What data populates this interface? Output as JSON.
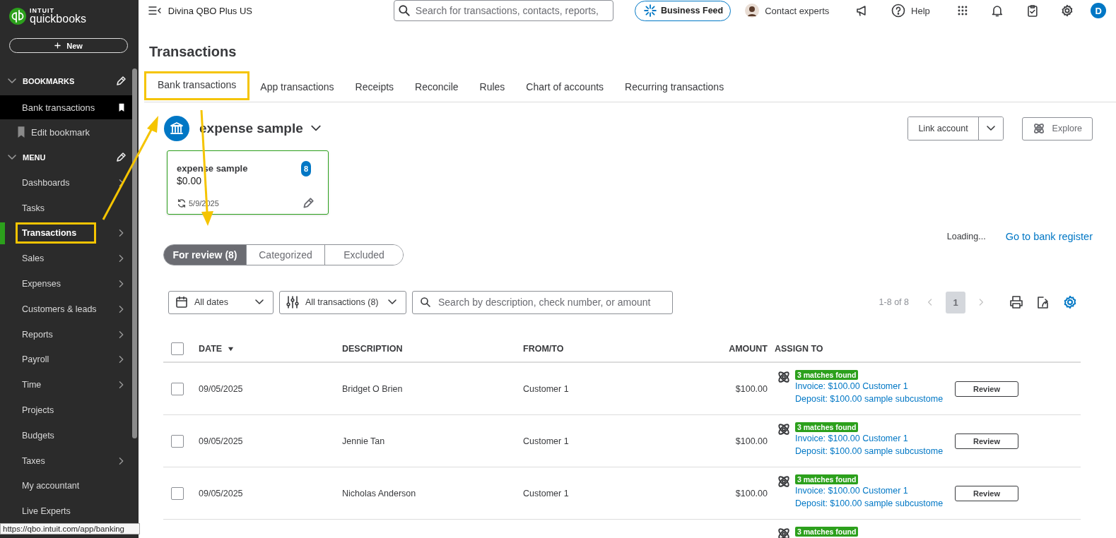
{
  "sidebar": {
    "logo": {
      "maker": "INTUIT",
      "product": "quickbooks"
    },
    "new_button": "New",
    "bookmarks": {
      "title": "BOOKMARKS",
      "expanded": true,
      "items": [
        {
          "label": "Bank transactions",
          "selected": true
        }
      ],
      "edit_label": "Edit bookmark"
    },
    "menu": {
      "title": "MENU",
      "expanded": true,
      "items": [
        {
          "label": "Dashboards",
          "selected": false,
          "submenu": true,
          "highlighted": false
        },
        {
          "label": "Tasks",
          "selected": false,
          "submenu": false,
          "highlighted": false
        },
        {
          "label": "Transactions",
          "selected": true,
          "submenu": true,
          "highlighted": true
        },
        {
          "label": "Sales",
          "selected": false,
          "submenu": true,
          "highlighted": false
        },
        {
          "label": "Expenses",
          "selected": false,
          "submenu": true,
          "highlighted": false
        },
        {
          "label": "Customers & leads",
          "selected": false,
          "submenu": true,
          "highlighted": false
        },
        {
          "label": "Reports",
          "selected": false,
          "submenu": true,
          "highlighted": false
        },
        {
          "label": "Payroll",
          "selected": false,
          "submenu": true,
          "highlighted": false
        },
        {
          "label": "Time",
          "selected": false,
          "submenu": true,
          "highlighted": false
        },
        {
          "label": "Projects",
          "selected": false,
          "submenu": false,
          "highlighted": false
        },
        {
          "label": "Budgets",
          "selected": false,
          "submenu": false,
          "highlighted": false
        },
        {
          "label": "Taxes",
          "selected": false,
          "submenu": true,
          "highlighted": false
        },
        {
          "label": "My accountant",
          "selected": false,
          "submenu": false,
          "highlighted": false
        },
        {
          "label": "Live Experts",
          "selected": false,
          "submenu": false,
          "highlighted": false
        }
      ]
    },
    "url_tooltip": "https://qbo.intuit.com/app/banking"
  },
  "topbar": {
    "company": "Divina QBO Plus US",
    "search": {
      "placeholder": "Search for transactions, contacts, reports,"
    },
    "business_feed": "Business Feed",
    "contact": "Contact experts",
    "help": "Help",
    "avatar": "D"
  },
  "page": {
    "title": "Transactions",
    "tabs": [
      {
        "label": "Bank transactions",
        "selected": true,
        "highlighted": true
      },
      {
        "label": "App transactions",
        "selected": false,
        "highlighted": false
      },
      {
        "label": "Receipts",
        "selected": false,
        "highlighted": false
      },
      {
        "label": "Reconcile",
        "selected": false,
        "highlighted": false
      },
      {
        "label": "Rules",
        "selected": false,
        "highlighted": false
      },
      {
        "label": "Chart of accounts",
        "selected": false,
        "highlighted": false
      },
      {
        "label": "Recurring transactions",
        "selected": false,
        "highlighted": false
      }
    ],
    "account": {
      "name": "expense sample",
      "link_account": "Link account",
      "explore": "Explore"
    },
    "account_card": {
      "name": "expense sample",
      "balance": "$0.00",
      "badge": "8",
      "updated": "5/9/2025",
      "selected": true
    },
    "status": "Loading...",
    "register_link": "Go to bank register",
    "views": [
      {
        "label": "For review (8)",
        "selected": true
      },
      {
        "label": "Categorized",
        "selected": false
      },
      {
        "label": "Excluded",
        "selected": false
      }
    ],
    "filters": {
      "dates": "All dates",
      "transactions": "All transactions (8)",
      "search": {
        "placeholder": "Search by description, check number, or amount"
      }
    },
    "pagination": {
      "range": "1-8 of 8",
      "page": "1"
    },
    "table": {
      "columns": [
        {
          "label": "DATE",
          "sorted": true
        },
        {
          "label": "DESCRIPTION",
          "sorted": false
        },
        {
          "label": "FROM/TO",
          "sorted": false
        },
        {
          "label": "AMOUNT",
          "sorted": false
        },
        {
          "label": "ASSIGN TO",
          "sorted": false
        }
      ],
      "all_checked": false,
      "rows": [
        {
          "checked": false,
          "date": "09/05/2025",
          "description": "Bridget O Brien",
          "from_to": "Customer 1",
          "amount": "$100.00",
          "match_badge": "3 matches found",
          "matches": [
            "Invoice: $100.00 Customer 1",
            "Deposit: $100.00 sample subcustome"
          ],
          "action": "Review"
        },
        {
          "checked": false,
          "date": "09/05/2025",
          "description": "Jennie Tan",
          "from_to": "Customer 1",
          "amount": "$100.00",
          "match_badge": "3 matches found",
          "matches": [
            "Invoice: $100.00 Customer 1",
            "Deposit: $100.00 sample subcustome"
          ],
          "action": "Review"
        },
        {
          "checked": false,
          "date": "09/05/2025",
          "description": "Nicholas Anderson",
          "from_to": "Customer 1",
          "amount": "$100.00",
          "match_badge": "3 matches found",
          "matches": [
            "Invoice: $100.00 Customer 1",
            "Deposit: $100.00 sample subcustome"
          ],
          "action": "Review"
        },
        {
          "match_badge": "3 matches found"
        }
      ]
    }
  }
}
